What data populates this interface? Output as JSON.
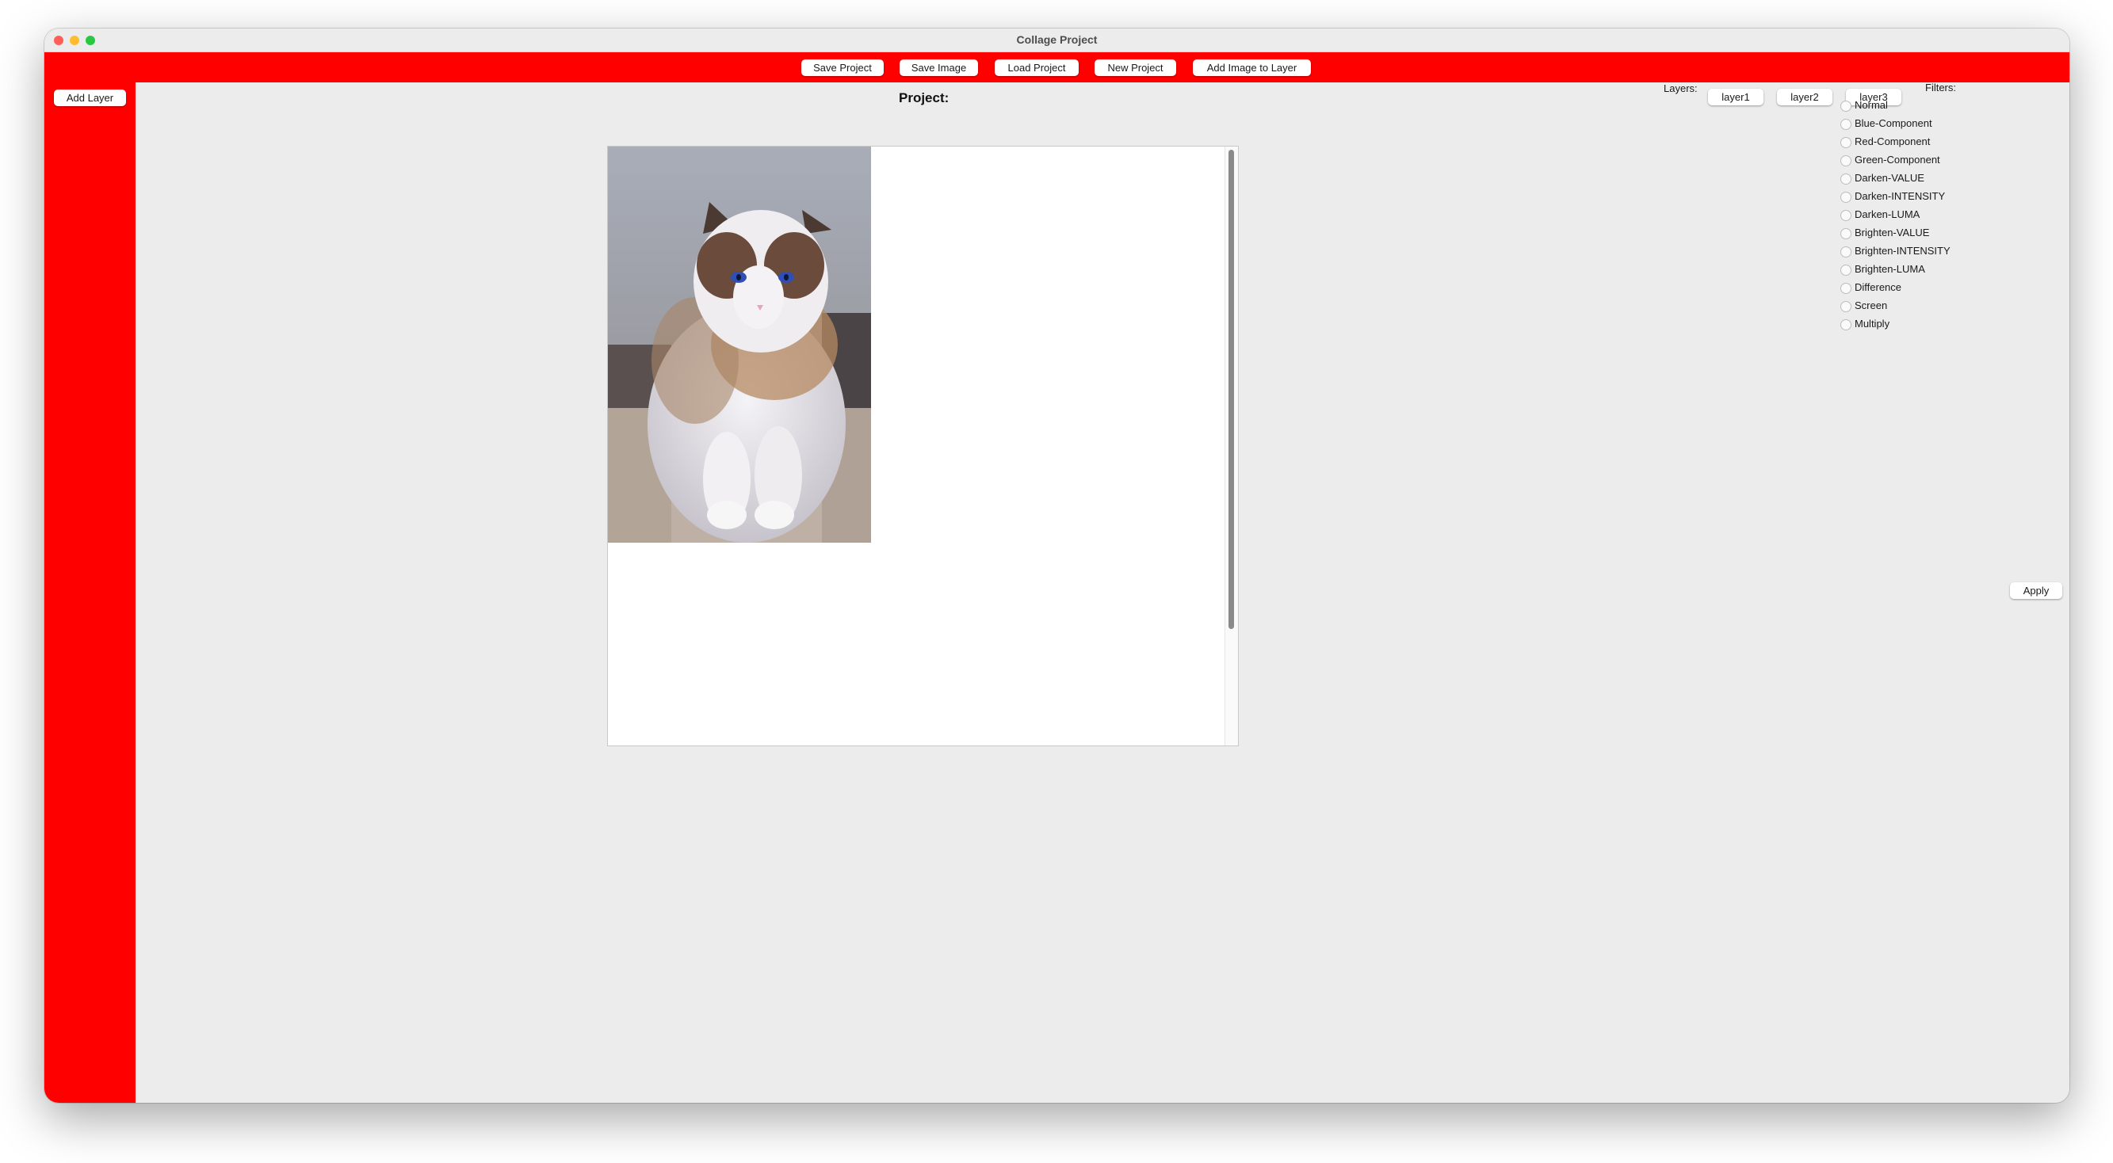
{
  "window": {
    "title": "Collage Project"
  },
  "toolbar": {
    "buttons": [
      "Save Project",
      "Save Image",
      "Load Project",
      "New Project",
      "Add Image to Layer"
    ]
  },
  "sidebar": {
    "add_layer_label": "Add Layer"
  },
  "main": {
    "project_label": "Project:"
  },
  "layers": {
    "label": "Layers:",
    "items": [
      "layer1",
      "layer2",
      "layer3"
    ]
  },
  "filters": {
    "label": "Filters:",
    "options": [
      "Normal",
      "Blue-Component",
      "Red-Component",
      "Green-Component",
      "Darken-VALUE",
      "Darken-INTENSITY",
      "Darken-LUMA",
      "Brighten-VALUE",
      "Brighten-INTENSITY",
      "Brighten-LUMA",
      "Difference",
      "Screen",
      "Multiply"
    ],
    "apply_label": "Apply"
  },
  "colors": {
    "accent": "#ff0000",
    "background": "#ececec"
  }
}
